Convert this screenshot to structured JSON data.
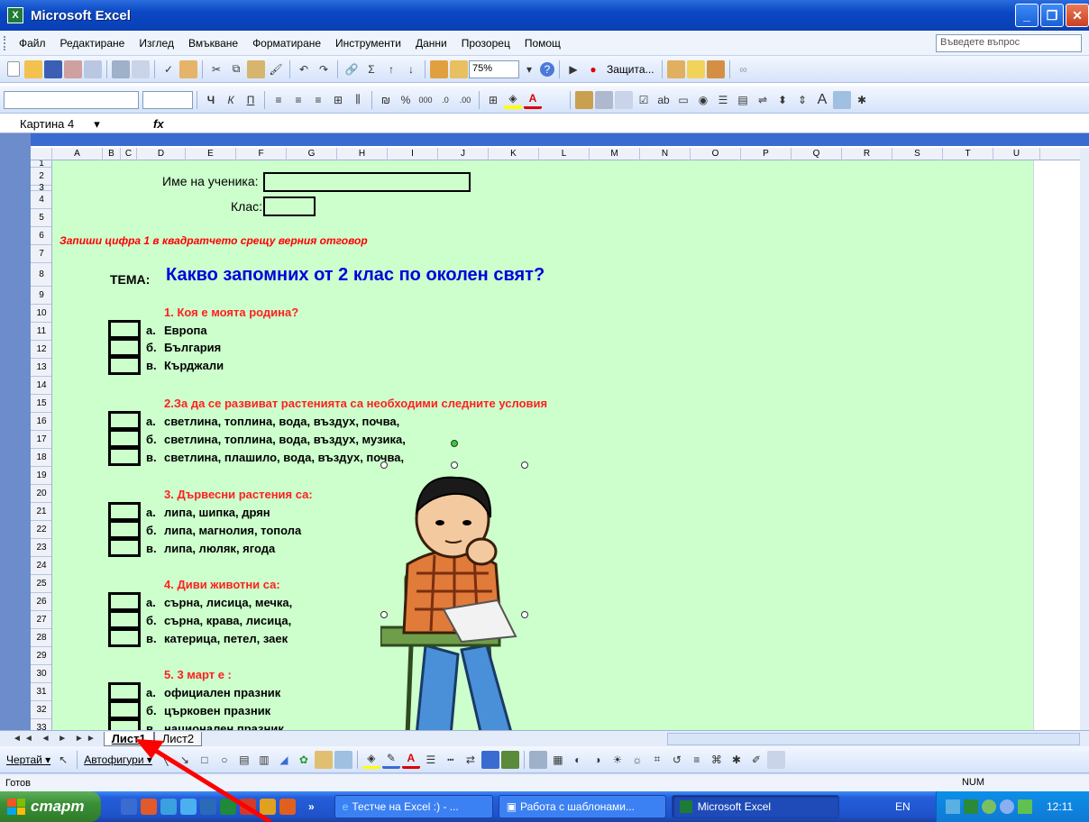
{
  "window": {
    "title": "Microsoft Excel",
    "buttons": [
      "_",
      "❐",
      "✕"
    ]
  },
  "menu": {
    "items": [
      "Файл",
      "Редактиране",
      "Изглед",
      "Вмъкване",
      "Форматиране",
      "Инструменти",
      "Данни",
      "Прозорец",
      "Помощ"
    ],
    "ask_placeholder": "Въведете въпрос"
  },
  "toolbar": {
    "zoom": "75%",
    "protect_label": "Защита..."
  },
  "formula_bar": {
    "name_box": "Картина 4",
    "fx": "fx"
  },
  "columns": [
    "A",
    "B",
    "C",
    "D",
    "E",
    "F",
    "G",
    "H",
    "I",
    "J",
    "K",
    "L",
    "M",
    "N",
    "O",
    "P",
    "Q",
    "R",
    "S",
    "T",
    "U"
  ],
  "rows": [
    "1",
    "2",
    "3",
    "4",
    "5",
    "6",
    "7",
    "8",
    "9",
    "10",
    "11",
    "12",
    "13",
    "14",
    "15",
    "16",
    "17",
    "18",
    "19",
    "20",
    "21",
    "22",
    "23",
    "24",
    "25",
    "26",
    "27",
    "28",
    "29",
    "30",
    "31",
    "32",
    "33"
  ],
  "worksheet": {
    "student_name_label": "Име на ученика:",
    "class_label": "Клас:",
    "instruction": "Запиши цифра 1 в квадратчето срещу верния отговор",
    "theme_label": "ТЕМА:",
    "heading": "Какво запомних от 2 клас по околен свят?",
    "questions": [
      {
        "text": "1. Коя е моята родина?",
        "answers": [
          "а.",
          "б.",
          "в."
        ],
        "options": [
          "Европа",
          "България",
          "Кърджали"
        ]
      },
      {
        "text": "2.За да се развиват растенията са необходими следните условия",
        "answers": [
          "а.",
          "б.",
          "в."
        ],
        "options": [
          "светлина, топлина, вода, въздух, почва,",
          "светлина, топлина, вода, въздух, музика,",
          "светлина, плашило, вода, въздух, почва,"
        ]
      },
      {
        "text": "3. Дървесни растения са:",
        "answers": [
          "а.",
          "б.",
          "в."
        ],
        "options": [
          "липа, шипка, дрян",
          "липа, магнолия, топола",
          "липа, люляк, ягода"
        ]
      },
      {
        "text": "4. Диви животни са:",
        "answers": [
          "а.",
          "б.",
          "в."
        ],
        "options": [
          "сърна, лисица, мечка,",
          "сърна, крава, лисица,",
          "катерица, петел, заек"
        ]
      },
      {
        "text": "5. 3 март е :",
        "answers": [
          "а.",
          "б.",
          "в."
        ],
        "options": [
          "официален празник",
          "църковен празник",
          "национален празник"
        ]
      }
    ]
  },
  "sheet_tabs": {
    "nav": "◄◄ ◄ ► ►►",
    "tabs": [
      "Лист1",
      "Лист2"
    ],
    "active": "Лист1"
  },
  "drawing_toolbar": {
    "draw_label": "Чертай ▾",
    "autoshapes_label": "Автофигури ▾"
  },
  "status": {
    "ready": "Готов",
    "num": "NUM"
  },
  "taskbar": {
    "start": "старт",
    "overflow": "»",
    "tasks": [
      "Тестче на Excel :) - ...",
      "Работа с шаблонами...",
      "Microsoft Excel"
    ],
    "active_task": "Microsoft Excel",
    "lang": "EN",
    "time": "12:11"
  },
  "colors": {
    "sheet_background": "#ccffcc",
    "question_red": "#ff2020",
    "heading_blue": "#0000dd",
    "annotation_arrow": "#ff0000"
  }
}
